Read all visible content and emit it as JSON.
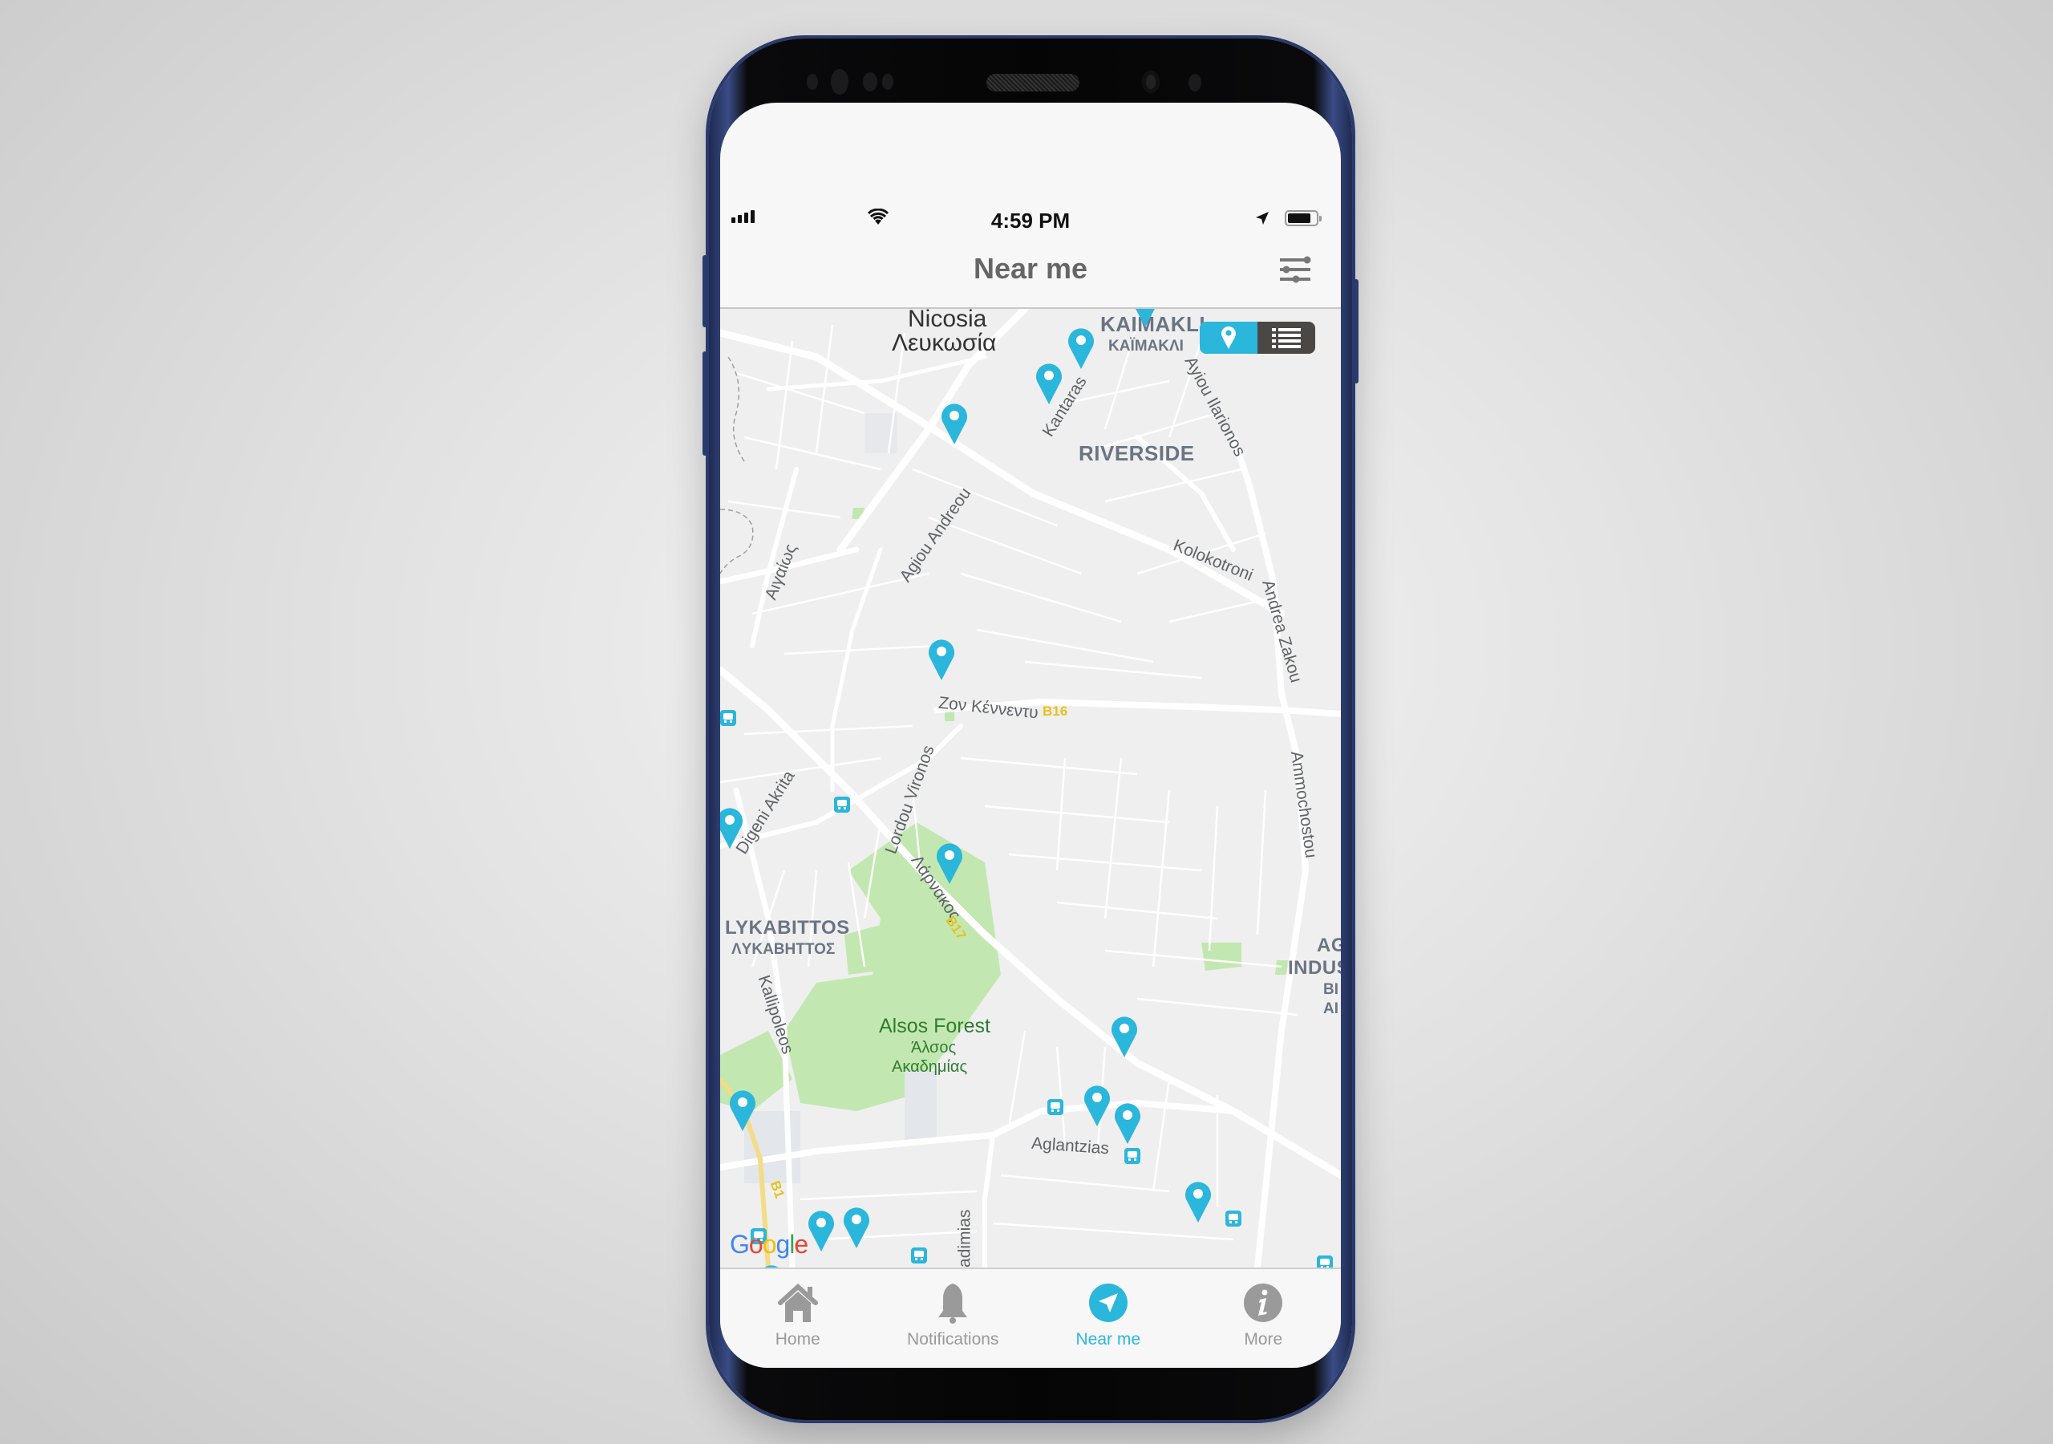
{
  "status_bar": {
    "time": "4:59 PM",
    "signal_icon": "cellular-signal-icon",
    "wifi_icon": "wifi-icon",
    "location_icon": "location-arrow-icon",
    "battery_icon": "battery-icon"
  },
  "header": {
    "title": "Near me",
    "filter_icon": "sliders-filter-icon"
  },
  "view_toggle": {
    "options": [
      {
        "name": "map-view",
        "icon": "map-pin-icon",
        "active": true
      },
      {
        "name": "list-view",
        "icon": "list-icon",
        "active": false
      }
    ]
  },
  "map": {
    "labels": {
      "city_en": "Nicosia",
      "city_gr": "Λευκωσία",
      "kaimakli_en": "KAIMAKLI",
      "kaimakli_gr": "KAÏMAKΛI",
      "riverside": "RIVERSIDE",
      "lykabittos_en": "LYKABITTOS",
      "lykabittos_gr": "ΛYKABHTTOΣ",
      "alsos_en": "Alsos Forest",
      "alsos_gr1": "Άλσος",
      "alsos_gr2": "Ακαδημίας",
      "industrial_1": "AG",
      "industrial_2": "INDUS",
      "industrial_3": "BI",
      "industrial_4": "AI",
      "street_kantaras": "Kantaras",
      "street_ayiou_ilarionos": "Ayiou Ilarionos",
      "street_kolokotroni": "Kolokotroni",
      "street_andrea_zakou": "Andrea Zakou",
      "street_ammochostou": "Ammochostou",
      "street_agiou_andreou": "Agiou Andreou",
      "street_aigaios": "Αιγαίως",
      "street_kennedy": "Ζον Κέννεντυ",
      "street_digeni_akrita": "Digeni Akrita",
      "street_lordou_vironos": "Lordou Vironos",
      "street_larnakos": "Λάρνακος",
      "street_kallipoleos": "Kallipoleos",
      "street_aglantzias": "Aglantzias",
      "street_akadimias": "kadimias",
      "route_b16": "B16",
      "route_b17": "B17",
      "route_b1": "B1"
    },
    "pin_count": 17,
    "attribution": "Google"
  },
  "colors": {
    "accent": "#2bb6dc",
    "toggle_inactive": "#4a4745",
    "tab_inactive": "#9a9a9a",
    "park": "#c3e7b0",
    "area_label": "#6b7483"
  },
  "tabs": [
    {
      "label": "Home",
      "icon": "home-icon",
      "active": false
    },
    {
      "label": "Notifications",
      "icon": "bell-icon",
      "active": false
    },
    {
      "label": "Near me",
      "icon": "navigation-arrow-icon",
      "active": true
    },
    {
      "label": "More",
      "icon": "info-icon",
      "active": false
    }
  ]
}
